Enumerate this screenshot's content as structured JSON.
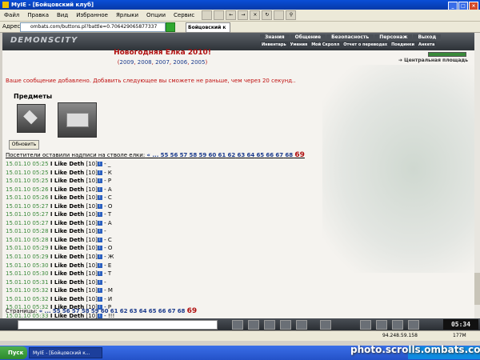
{
  "window": {
    "title": "MyIE - [Бойцовский клуб]"
  },
  "menu": [
    "Файл",
    "Правка",
    "Вид",
    "Избранное",
    "Ярлыки",
    "Опции",
    "Сервис"
  ],
  "address": {
    "label": "Адрес",
    "value": "ombats.com/buttons.pl?battle=0.706429065877337",
    "tab": "Бойцовский к"
  },
  "site": {
    "logo": "DEMONSCITY",
    "nav_top": [
      "Знания",
      "Общение",
      "Безопасность",
      "Персонаж",
      "Выход"
    ],
    "nav_sub": [
      "Инвентарь",
      "Умения",
      "Мой Скролл",
      "Отчет о переводах",
      "Поединки",
      "Анкета"
    ],
    "place": "Центральная площадь",
    "title": "Новогодняя Елка 2010!",
    "years": [
      "2009",
      "2008",
      "2007",
      "2006",
      "2005"
    ],
    "message": "Ваше сообщение добавлено. Добавить следующее вы сможете не раньше, чем через 20 секунд..",
    "items_label": "Предметы",
    "refresh": "Обновить",
    "visitors": "Посетители оставили надписи на стволе елки:",
    "pages_label": "Страницы:",
    "pages": [
      "55",
      "56",
      "57",
      "58",
      "59",
      "60",
      "61",
      "62",
      "63",
      "64",
      "65",
      "66",
      "67",
      "68"
    ],
    "current_page": "69",
    "rows": [
      {
        "time": "15.01.10 05:25",
        "name": "I Like Deth",
        "level": "[10]",
        "text": "- _"
      },
      {
        "time": "15.01.10 05:25",
        "name": "I Like Deth",
        "level": "[10]",
        "text": "- К"
      },
      {
        "time": "15.01.10 05:25",
        "name": "I Like Deth",
        "level": "[10]",
        "text": "- Р"
      },
      {
        "time": "15.01.10 05:26",
        "name": "I Like Deth",
        "level": "[10]",
        "text": "- А"
      },
      {
        "time": "15.01.10 05:26",
        "name": "I Like Deth",
        "level": "[10]",
        "text": "- С"
      },
      {
        "time": "15.01.10 05:27",
        "name": "I Like Deth",
        "level": "[10]",
        "text": "- О"
      },
      {
        "time": "15.01.10 05:27",
        "name": "I Like Deth",
        "level": "[10]",
        "text": "- Т"
      },
      {
        "time": "15.01.10 05:27",
        "name": "I Like Deth",
        "level": "[10]",
        "text": "- А"
      },
      {
        "time": "15.01.10 05:28",
        "name": "I Like Deth",
        "level": "[10]",
        "text": "-"
      },
      {
        "time": "15.01.10 05:28",
        "name": "I Like Deth",
        "level": "[10]",
        "text": "- С"
      },
      {
        "time": "15.01.10 05:29",
        "name": "I Like Deth",
        "level": "[10]",
        "text": "- О"
      },
      {
        "time": "15.01.10 05:29",
        "name": "I Like Deth",
        "level": "[10]",
        "text": "- Ж"
      },
      {
        "time": "15.01.10 05:30",
        "name": "I Like Deth",
        "level": "[10]",
        "text": "- Е"
      },
      {
        "time": "15.01.10 05:30",
        "name": "I Like Deth",
        "level": "[10]",
        "text": "- Т"
      },
      {
        "time": "15.01.10 05:31",
        "name": "I Like Deth",
        "level": "[10]",
        "text": "-"
      },
      {
        "time": "15.01.10 05:32",
        "name": "I Like Deth",
        "level": "[10]",
        "text": "- М"
      },
      {
        "time": "15.01.10 05:32",
        "name": "I Like Deth",
        "level": "[10]",
        "text": "- И"
      },
      {
        "time": "15.01.10 05:32",
        "name": "I Like Deth",
        "level": "[10]",
        "text": "- Р"
      },
      {
        "time": "15.01.10 05:33",
        "name": "I Like Deth",
        "level": "[10]",
        "text": "- !!!"
      }
    ]
  },
  "clock": "05:34",
  "status": {
    "ip": "94.248.59.158",
    "mem": "177M"
  },
  "taskbar": {
    "start": "Пуск",
    "task": "MyIE - [Бойцовский к..."
  },
  "watermark": "photo.scrolls.ombats.com",
  "colors": {
    "title_red": "#b01010",
    "link_blue": "#1a3a8c",
    "time_green": "#3a8a3a"
  }
}
